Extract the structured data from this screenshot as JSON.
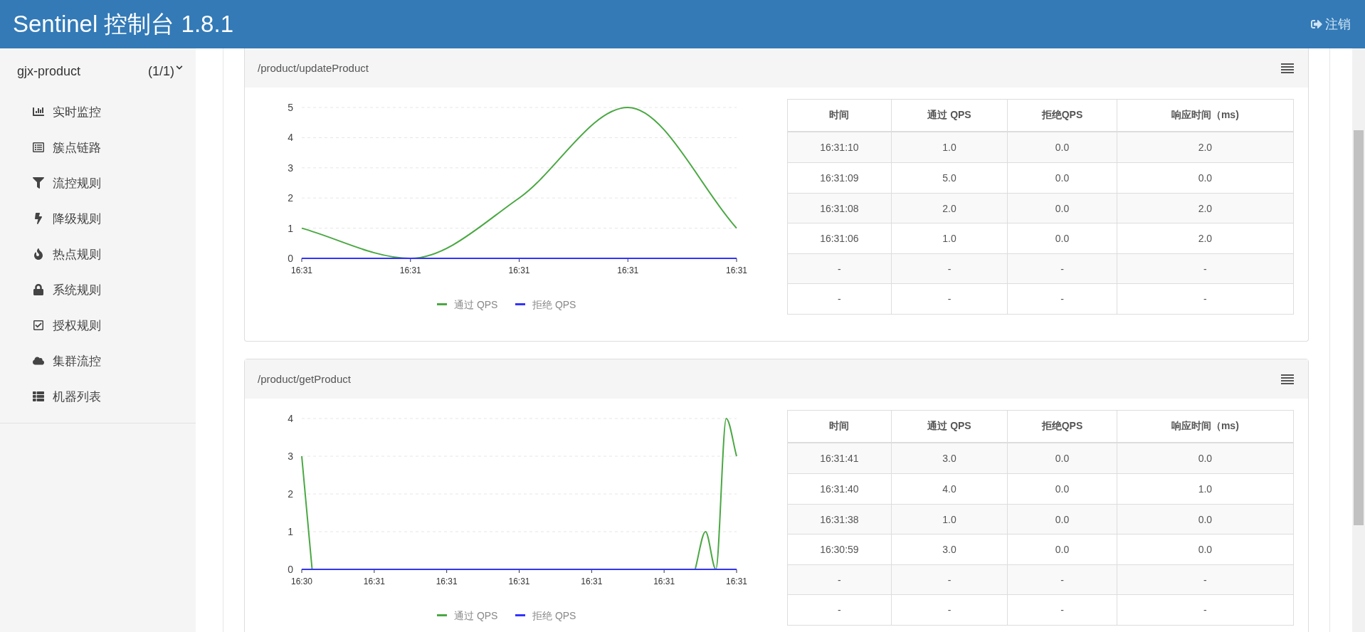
{
  "header": {
    "title": "Sentinel 控制台 1.8.1",
    "logout": "注销"
  },
  "sidebar": {
    "app": {
      "name": "gjx-product",
      "count": "(1/1)",
      "expanded": true
    },
    "items": [
      {
        "label": "实时监控"
      },
      {
        "label": "簇点链路"
      },
      {
        "label": "流控规则"
      },
      {
        "label": "降级规则"
      },
      {
        "label": "热点规则"
      },
      {
        "label": "系统规则"
      },
      {
        "label": "授权规则"
      },
      {
        "label": "集群流控"
      },
      {
        "label": "机器列表"
      }
    ]
  },
  "cards": [
    {
      "resource": "/product/updateProduct",
      "chart_data": {
        "type": "line",
        "grid": true,
        "legend": true,
        "categories": [
          "16:31",
          "16:31",
          "16:31",
          "16:31",
          "16:31"
        ],
        "ylim": [
          0,
          5
        ],
        "yticks": [
          0,
          1,
          2,
          3,
          4,
          5
        ],
        "series": [
          {
            "name": "通过 QPS",
            "color": "#4aa843",
            "values": [
              1,
              0,
              2,
              5,
              1
            ]
          },
          {
            "name": "拒绝 QPS",
            "color": "#3333ff",
            "values": [
              0,
              0,
              0,
              0,
              0
            ]
          }
        ]
      },
      "table": {
        "columns": [
          "时间",
          "通过 QPS",
          "拒绝QPS",
          "响应时间（ms)"
        ],
        "rows": [
          [
            "16:31:10",
            "1.0",
            "0.0",
            "2.0"
          ],
          [
            "16:31:09",
            "5.0",
            "0.0",
            "0.0"
          ],
          [
            "16:31:08",
            "2.0",
            "0.0",
            "2.0"
          ],
          [
            "16:31:06",
            "1.0",
            "0.0",
            "2.0"
          ],
          [
            "-",
            "-",
            "-",
            "-"
          ],
          [
            "-",
            "-",
            "-",
            "-"
          ]
        ]
      }
    },
    {
      "resource": "/product/getProduct",
      "chart_data": {
        "type": "line",
        "categories": [
          "16:30",
          null,
          null,
          null,
          null,
          null,
          null,
          "16:31",
          null,
          null,
          null,
          null,
          null,
          null,
          "16:31",
          null,
          null,
          null,
          null,
          null,
          null,
          "16:31",
          null,
          null,
          null,
          null,
          null,
          null,
          "16:31",
          null,
          null,
          null,
          null,
          null,
          null,
          "16:31",
          null,
          null,
          null,
          null,
          null,
          null,
          "16:31"
        ],
        "grid": true,
        "legend": true,
        "ylim": [
          0,
          4
        ],
        "yticks": [
          0,
          1,
          2,
          3,
          4
        ],
        "series": [
          {
            "name": "通过 QPS",
            "color": "#4aa843",
            "values": [
              3,
              0,
              null,
              null,
              null,
              null,
              null,
              null,
              null,
              null,
              null,
              null,
              null,
              null,
              null,
              null,
              null,
              null,
              null,
              null,
              null,
              null,
              null,
              null,
              null,
              null,
              null,
              null,
              null,
              null,
              null,
              null,
              null,
              null,
              null,
              null,
              null,
              null,
              0,
              1,
              0,
              4,
              3
            ]
          },
          {
            "name": "拒绝 QPS",
            "color": "#3333ff",
            "values": [
              0,
              0,
              0,
              0,
              0,
              0,
              0,
              0,
              0,
              0,
              0,
              0,
              0,
              0,
              0,
              0,
              0,
              0,
              0,
              0,
              0,
              0,
              0,
              0,
              0,
              0,
              0,
              0,
              0,
              0,
              0,
              0,
              0,
              0,
              0,
              0,
              0,
              0,
              0,
              0,
              0,
              0,
              0
            ]
          }
        ]
      },
      "table": {
        "columns": [
          "时间",
          "通过 QPS",
          "拒绝QPS",
          "响应时间（ms)"
        ],
        "rows": [
          [
            "16:31:41",
            "3.0",
            "0.0",
            "0.0"
          ],
          [
            "16:31:40",
            "4.0",
            "0.0",
            "1.0"
          ],
          [
            "16:31:38",
            "1.0",
            "0.0",
            "0.0"
          ],
          [
            "16:30:59",
            "3.0",
            "0.0",
            "0.0"
          ],
          [
            "-",
            "-",
            "-",
            "-"
          ],
          [
            "-",
            "-",
            "-",
            "-"
          ]
        ]
      }
    }
  ]
}
